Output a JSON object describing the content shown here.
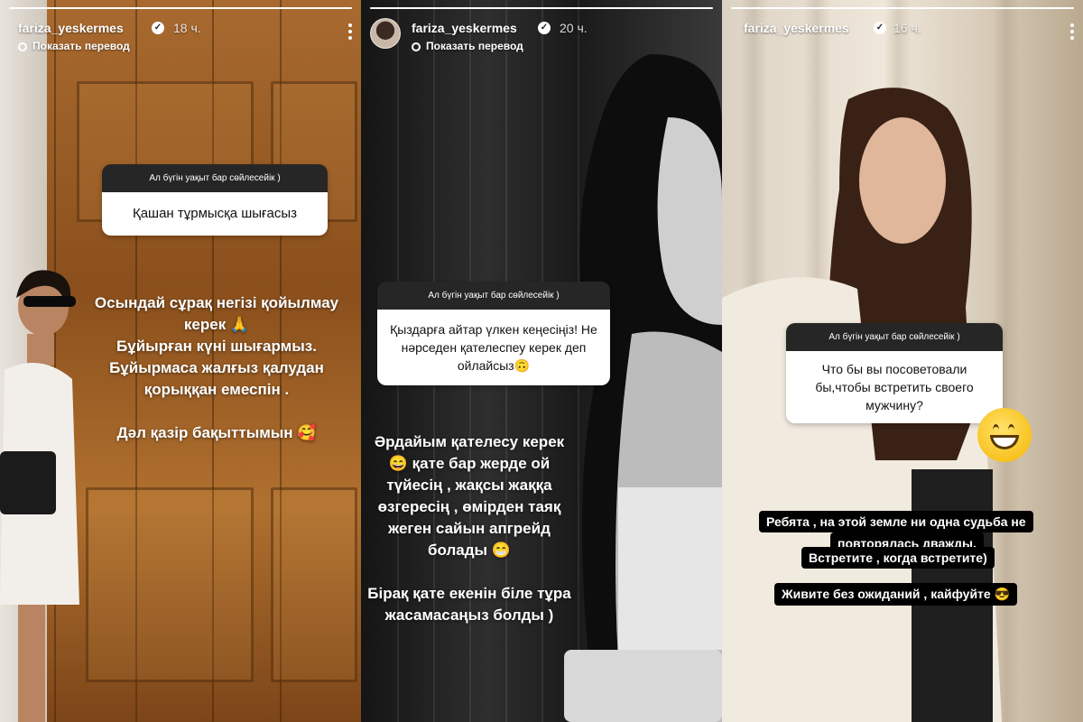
{
  "stories": [
    {
      "username": "fariza_yeskermes",
      "time": "18 ч.",
      "translate": "Показать перевод",
      "question_header": "Ал бүгін уақыт бар сөйлесейік )",
      "question": "Қашан тұрмысқа шығасыз",
      "answer": "Осындай сұрақ негізі қойылмау\nкерек 🙏\nБұйырған күні шығармыз.\nБұйырмаса жалғыз қалудан\nқорыққан емеспін .\n\nДәл қазір бақыттымын 🥰"
    },
    {
      "username": "fariza_yeskermes",
      "time": "20 ч.",
      "translate": "Показать перевод",
      "question_header": "Ал бүгін уақыт бар сөйлесейік )",
      "question": "Қыздарға айтар үлкен кеңесіңіз! Не нәрседен қателеспеу керек деп ойлайсыз🙃",
      "answer": "Әрдайым қателесу керек\n😄 қате бар жерде ой\nтүйесің , жақсы жаққа\nөзгересің , өмірден таяқ\nжеген сайын апгрейд\nболады 😁\n\nБірақ қате екенін біле тұра\nжасамасаңыз болды )"
    },
    {
      "username": "fariza_yeskermes",
      "time": "16 ч.",
      "question_header": "Ал бүгін уақыт бар сөйлесейік )",
      "question": "Что бы вы посоветовали бы,чтобы встретить своего мужчину?",
      "answer_lines": [
        "Ребята , на этой земле ни одна судьба не",
        "повторялась дважды.",
        "Встретите , когда встретите)",
        "Живите без ожиданий , кайфуйте 😎"
      ]
    }
  ]
}
